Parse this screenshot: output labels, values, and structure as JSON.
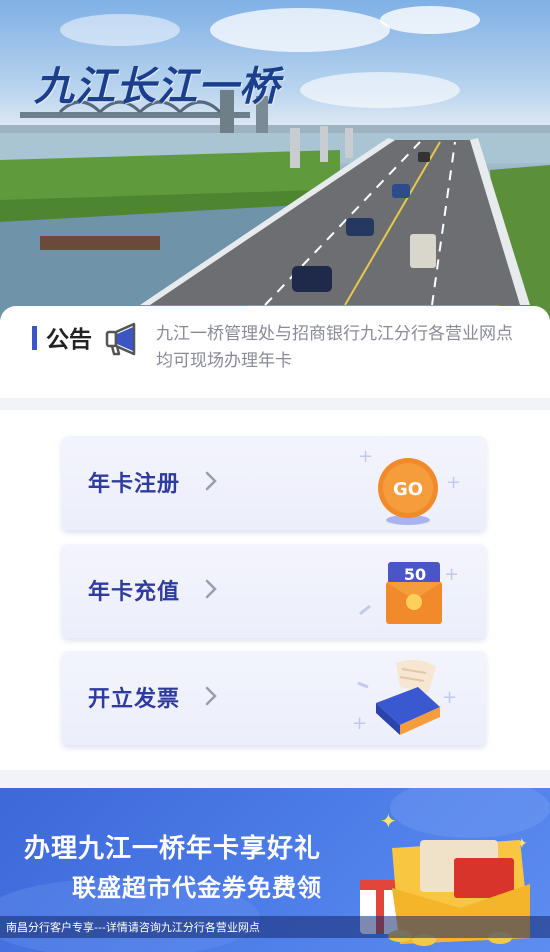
{
  "hero": {
    "title": "九江长江一桥",
    "colors": {
      "title": "#1b3f8c"
    }
  },
  "notice": {
    "title": "公告",
    "text": "九江一桥管理处与招商银行九江分行各营业网点均可现场办理年卡",
    "icon": "megaphone-icon"
  },
  "menu": [
    {
      "label": "年卡注册",
      "icon": "go-coin-icon",
      "badge": "GO"
    },
    {
      "label": "年卡充值",
      "icon": "voucher-50-icon",
      "badge": "50"
    },
    {
      "label": "开立发票",
      "icon": "invoice-box-icon"
    }
  ],
  "banner": {
    "line1": "办理九江一桥年卡享好礼",
    "line2": "联盛超市代金券免费领",
    "footer": "南昌分行客户专享---详情请咨询九江分行各营业网点"
  },
  "colors": {
    "accent": "#3c55c5",
    "card_label": "#2f3c9e",
    "banner": "#4a7ae6",
    "coin": "#f08a2a"
  }
}
